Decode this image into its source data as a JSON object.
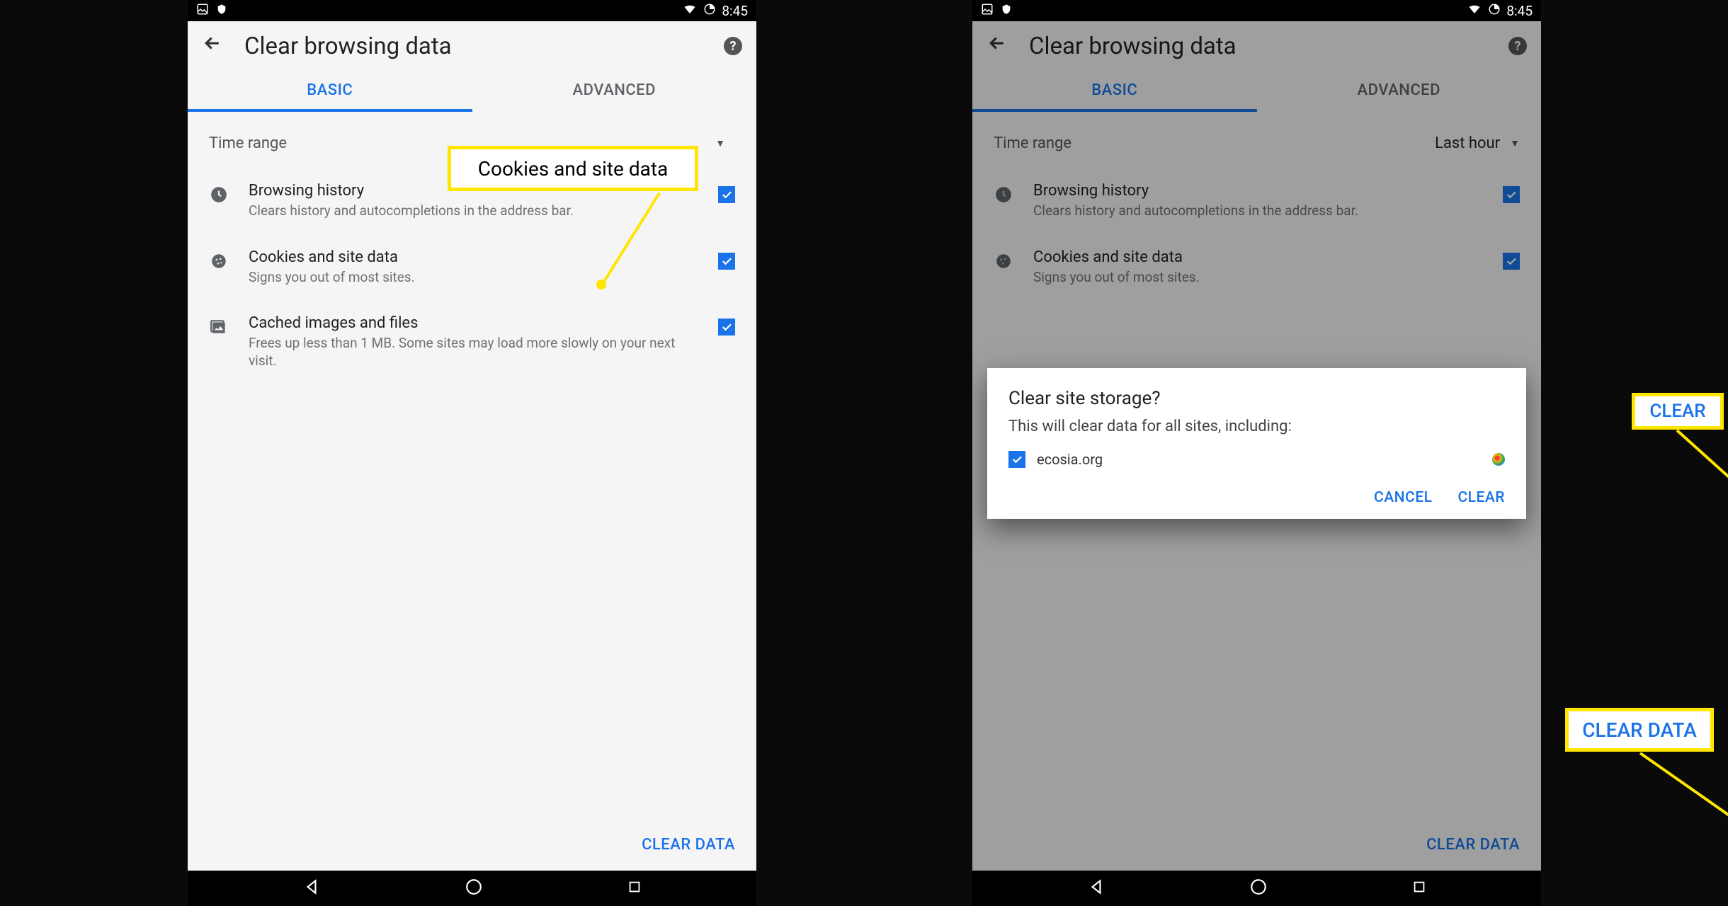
{
  "status": {
    "time": "8:45"
  },
  "header": {
    "title": "Clear browsing data"
  },
  "tabs": {
    "basic": "BASIC",
    "advanced": "ADVANCED"
  },
  "time_range": {
    "label": "Time range",
    "value": "Last hour"
  },
  "options": [
    {
      "title": "Browsing history",
      "desc": "Clears history and autocompletions in the address bar."
    },
    {
      "title": "Cookies and site data",
      "desc": "Signs you out of most sites."
    },
    {
      "title": "Cached images and files",
      "desc": "Frees up less than 1 MB. Some sites may load more slowly on your next visit."
    }
  ],
  "clear_button": "CLEAR DATA",
  "dialog": {
    "title": "Clear site storage?",
    "text": "This will clear data for all sites, including:",
    "site": "ecosia.org",
    "cancel": "CANCEL",
    "clear": "CLEAR"
  },
  "annotations": {
    "cookies": "Cookies and site data",
    "clear": "CLEAR",
    "clear_data": "CLEAR DATA"
  }
}
